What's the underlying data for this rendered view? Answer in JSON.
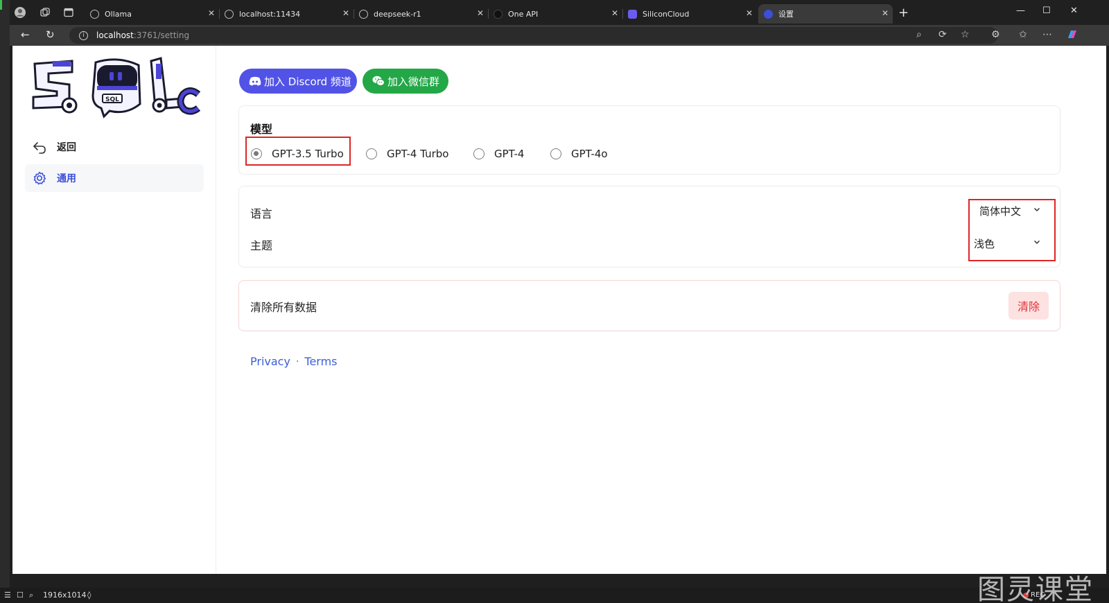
{
  "browser": {
    "tabs": [
      {
        "title": "Ollama",
        "active": false
      },
      {
        "title": "localhost:11434",
        "active": false
      },
      {
        "title": "deepseek-r1",
        "active": false
      },
      {
        "title": "One API",
        "active": false
      },
      {
        "title": "SiliconCloud",
        "active": false
      },
      {
        "title": "设置",
        "active": true
      }
    ],
    "url_host": "localhost",
    "url_path": ":3761/setting"
  },
  "sidebar": {
    "back_label": "返回",
    "general_label": "通用"
  },
  "community": {
    "discord_label": "加入 Discord 频道",
    "wechat_label": "加入微信群"
  },
  "model": {
    "title": "模型",
    "options": [
      "GPT-3.5 Turbo",
      "GPT-4 Turbo",
      "GPT-4",
      "GPT-4o"
    ],
    "selected": "GPT-3.5 Turbo"
  },
  "prefs": {
    "language_label": "语言",
    "language_value": "简体中文",
    "theme_label": "主题",
    "theme_value": "浅色"
  },
  "danger": {
    "label": "清除所有数据",
    "button": "清除"
  },
  "footer": {
    "privacy": "Privacy",
    "separator": "·",
    "terms": "Terms"
  },
  "statusbar": {
    "resolution": "1916x1014",
    "rec": "REC"
  },
  "watermark": "图灵课堂",
  "colors": {
    "accent": "#3b4fd8",
    "discord": "#5153e6",
    "wechat": "#23a747",
    "danger_bg": "#fde2e2",
    "danger_text": "#e03434",
    "highlight": "#e02424"
  }
}
